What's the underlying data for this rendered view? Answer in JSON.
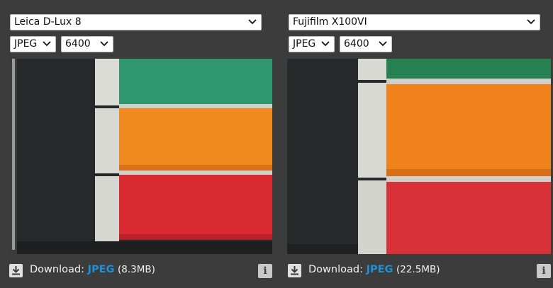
{
  "left": {
    "camera": "Leica D-Lux 8",
    "format": "JPEG",
    "iso": "6400",
    "download_label": "Download:",
    "download_format": "JPEG",
    "download_size": "(8.3MB)",
    "info_label": "i"
  },
  "right": {
    "camera": "Fujifilm X100VI",
    "format": "JPEG",
    "iso": "6400",
    "download_label": "Download:",
    "download_format": "JPEG",
    "download_size": "(22.5MB)",
    "info_label": "i"
  },
  "icons": {
    "dropdown": "chevron-down-icon",
    "download": "download-icon",
    "info": "info-icon"
  },
  "colors": {
    "background": "#3c3c3c",
    "link": "#1e90d6",
    "thread_green": "#2f9670",
    "thread_orange": "#f08a1e",
    "thread_red": "#d92a32"
  }
}
